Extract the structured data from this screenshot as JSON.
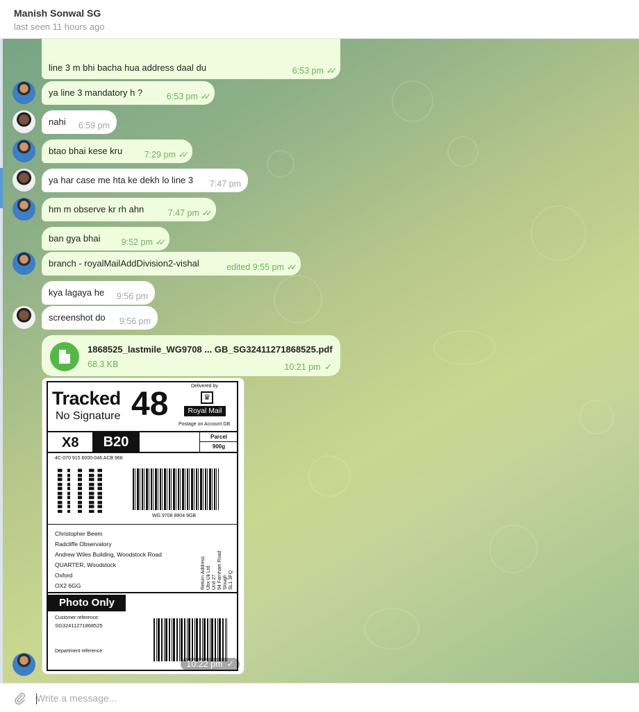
{
  "header": {
    "contact_name": "Manish Sonwal SG",
    "status": "last seen 11 hours ago"
  },
  "messages": [
    {
      "text": "line 3 m bhi bacha hua address daal du",
      "time": "6:53 pm",
      "outgoing": true,
      "ticks": "double"
    },
    {
      "text": "ya line 3 mandatory h  ?",
      "time": "6:53 pm",
      "outgoing": true,
      "ticks": "double"
    },
    {
      "text": "nahi",
      "time": "6:59 pm",
      "outgoing": false
    },
    {
      "text": "btao bhai kese kru",
      "time": "7:29 pm",
      "outgoing": true,
      "ticks": "double"
    },
    {
      "text": "ya har case me hta ke dekh lo line 3",
      "time": "7:47 pm",
      "outgoing": false
    },
    {
      "text": "hm m observe kr rh ahn",
      "time": "7:47 pm",
      "outgoing": true,
      "ticks": "double"
    },
    {
      "text": "ban gya bhai",
      "time": "9:52 pm",
      "outgoing": true,
      "ticks": "double"
    },
    {
      "text": "branch - royalMailAddDivision2-vishal",
      "time": "edited 9:55 pm",
      "outgoing": true,
      "ticks": "double"
    },
    {
      "text": "kya lagaya he",
      "time": "9:56 pm",
      "outgoing": false
    },
    {
      "text": "screenshot do",
      "time": "9:56 pm",
      "outgoing": false
    }
  ],
  "file_message": {
    "filename": "1868525_lastmile_WG9708 ... GB_SG32411271868525.pdf",
    "size": "68.3 KB",
    "time": "10:21 pm",
    "ticks": "single"
  },
  "photo_message": {
    "time": "10:22 pm",
    "ticks": "single",
    "label": {
      "service": "Tracked",
      "service_number": "48",
      "signature": "No Signature",
      "delivered_by": "Delivered by",
      "brand": "Royal Mail",
      "postage": "Postage on Account GB",
      "code_left": "X8",
      "code_box": "B20",
      "parcel": "Parcel",
      "weight": "900g",
      "routing": "4C-070 915 6000-046 ACB 968",
      "barcode_number": "WG 9708 8804 9GB",
      "address": [
        "Christopher Beem",
        "Radcliffe Observatory",
        "Andrew Wiles Building, Woodstock Road",
        "QUARTER, Woodstock",
        "Oxford",
        "OX2 6GG"
      ],
      "return_address": [
        "Return Address",
        "Ubx Uk Ltd",
        "Unit 27",
        "94 Farnham Road",
        "Slough",
        "SL1 3FQ"
      ],
      "photo_only": "Photo Only",
      "customer_reference_label": "Customer reference:",
      "customer_reference": "SG32411271868525",
      "department_reference_label": "Department reference:"
    }
  },
  "composer": {
    "placeholder": "Write a message...",
    "attach_icon": "paperclip-icon"
  },
  "colors": {
    "outgoing_bubble": "#effdde",
    "incoming_bubble": "#ffffff",
    "outgoing_meta": "#6cb05b",
    "file_icon": "#54b848"
  }
}
